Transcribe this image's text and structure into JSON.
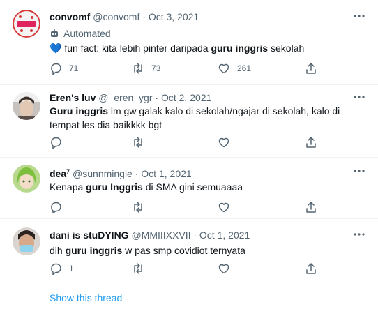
{
  "tweets": [
    {
      "name": "convomf",
      "name_sup": "",
      "handle": "@convomf",
      "date": "Oct 3, 2021",
      "automated_label": "Automated",
      "parts": [
        {
          "text": "💙 fun fact: kita lebih pinter daripada ",
          "bold": false
        },
        {
          "text": "guru inggris",
          "bold": true
        },
        {
          "text": " sekolah",
          "bold": false
        }
      ],
      "replies": "71",
      "retweets": "73",
      "likes": "261"
    },
    {
      "name": "Eren's luv",
      "name_sup": "",
      "handle": "@_eren_ygr",
      "date": "Oct 2, 2021",
      "parts": [
        {
          "text": "Guru inggris",
          "bold": true
        },
        {
          "text": " lm gw galak kalo di sekolah/ngajar di sekolah, kalo di tempat les dia baikkkk bgt",
          "bold": false
        }
      ],
      "replies": "",
      "retweets": "",
      "likes": ""
    },
    {
      "name": "dea",
      "name_sup": "7",
      "handle": "@sunnmingie",
      "date": "Oct 1, 2021",
      "parts": [
        {
          "text": "Kenapa ",
          "bold": false
        },
        {
          "text": "guru Inggris",
          "bold": true
        },
        {
          "text": " di SMA gini semuaaaa",
          "bold": false
        }
      ],
      "replies": "",
      "retweets": "",
      "likes": ""
    },
    {
      "name": "dani is stuDYING",
      "name_sup": "",
      "handle": "@MMIIIXXVII",
      "date": "Oct 1, 2021",
      "parts": [
        {
          "text": "dih ",
          "bold": false
        },
        {
          "text": "guru inggris",
          "bold": true
        },
        {
          "text": " w pas smp covidiot ternyata",
          "bold": false
        }
      ],
      "replies": "1",
      "retweets": "",
      "likes": ""
    }
  ],
  "show_thread_label": "Show this thread",
  "colors": {
    "accent": "#1d9bf0",
    "muted": "#536471",
    "text": "#0f1419",
    "divider": "#eff3f4"
  }
}
